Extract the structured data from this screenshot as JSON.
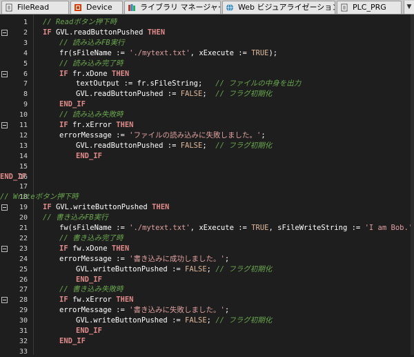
{
  "tabs": [
    {
      "label": "FileRead",
      "icon": "document-icon"
    },
    {
      "label": "Device",
      "icon": "device-icon"
    },
    {
      "label": "ライブラリ マネージャー",
      "icon": "library-icon"
    },
    {
      "label": "Web ビジュアライゼーション",
      "icon": "web-visu-icon"
    },
    {
      "label": "PLC_PRG",
      "icon": "document-icon"
    }
  ],
  "tab_overflow": "▼",
  "lines": [
    {
      "no": "1",
      "tokens": [
        {
          "t": "cm",
          "v": "// Readボタン押下時"
        }
      ]
    },
    {
      "no": "2",
      "tokens": [
        {
          "t": "kw",
          "v": "IF"
        },
        {
          "t": "tx",
          "v": " GVL.readButtonPushed "
        },
        {
          "t": "kw",
          "v": "THEN"
        }
      ]
    },
    {
      "no": "3",
      "tokens": [
        {
          "t": "cm",
          "v": "// 読み込みFB実行"
        }
      ]
    },
    {
      "no": "4",
      "tokens": [
        {
          "t": "tx",
          "v": "fr(sFileName := "
        },
        {
          "t": "st",
          "v": "'./mytext.txt'"
        },
        {
          "t": "tx",
          "v": ", xExecute := "
        },
        {
          "t": "op",
          "v": "TRUE"
        },
        {
          "t": "tx",
          "v": ");"
        }
      ]
    },
    {
      "no": "5",
      "tokens": [
        {
          "t": "cm",
          "v": "// 読み込み完了時"
        }
      ]
    },
    {
      "no": "6",
      "tokens": [
        {
          "t": "kw",
          "v": "IF"
        },
        {
          "t": "tx",
          "v": " fr.xDone "
        },
        {
          "t": "kw",
          "v": "THEN"
        }
      ]
    },
    {
      "no": "7",
      "tokens": [
        {
          "t": "tx",
          "v": "textOutput := fr.sFileString;   "
        },
        {
          "t": "cm",
          "v": "// ファイルの中身を出力"
        }
      ]
    },
    {
      "no": "8",
      "tokens": [
        {
          "t": "tx",
          "v": "GVL.readButtonPushed := "
        },
        {
          "t": "op",
          "v": "FALSE"
        },
        {
          "t": "tx",
          "v": ";  "
        },
        {
          "t": "cm",
          "v": "// フラグ初期化"
        }
      ]
    },
    {
      "no": "9",
      "tokens": [
        {
          "t": "kw",
          "v": "END_IF"
        }
      ]
    },
    {
      "no": "10",
      "tokens": [
        {
          "t": "cm",
          "v": "// 読み込み失敗時"
        }
      ]
    },
    {
      "no": "11",
      "tokens": [
        {
          "t": "kw",
          "v": "IF"
        },
        {
          "t": "tx",
          "v": " fr.xError "
        },
        {
          "t": "kw",
          "v": "THEN"
        }
      ]
    },
    {
      "no": "12",
      "tokens": [
        {
          "t": "tx",
          "v": "errorMessage := "
        },
        {
          "t": "st",
          "v": "'ファイルの読み込みに失敗しました。'"
        },
        {
          "t": "tx",
          "v": ";"
        }
      ]
    },
    {
      "no": "13",
      "tokens": [
        {
          "t": "tx",
          "v": "GVL.readButtonPushed := "
        },
        {
          "t": "op",
          "v": "FALSE"
        },
        {
          "t": "tx",
          "v": ";  "
        },
        {
          "t": "cm",
          "v": "// フラグ初期化"
        }
      ]
    },
    {
      "no": "14",
      "tokens": [
        {
          "t": "kw",
          "v": "END_IF"
        }
      ]
    },
    {
      "no": "15",
      "tokens": []
    },
    {
      "no": "16",
      "tokens": [
        {
          "t": "kw",
          "v": "END_IF"
        }
      ]
    },
    {
      "no": "17",
      "tokens": []
    },
    {
      "no": "18",
      "tokens": [
        {
          "t": "cm",
          "v": "// Writeボタン押下時"
        }
      ]
    },
    {
      "no": "19",
      "tokens": [
        {
          "t": "kw",
          "v": "IF"
        },
        {
          "t": "tx",
          "v": " GVL.writeButtonPushed "
        },
        {
          "t": "kw",
          "v": "THEN"
        }
      ]
    },
    {
      "no": "20",
      "tokens": [
        {
          "t": "cm",
          "v": "// 書き込みFB実行"
        }
      ]
    },
    {
      "no": "21",
      "tokens": [
        {
          "t": "tx",
          "v": "fw(sFileName := "
        },
        {
          "t": "st",
          "v": "'./mytext.txt'"
        },
        {
          "t": "tx",
          "v": ", xExecute := "
        },
        {
          "t": "op",
          "v": "TRUE"
        },
        {
          "t": "tx",
          "v": ", sFileWriteString := "
        },
        {
          "t": "st",
          "v": "'I am Bob.'"
        },
        {
          "t": "tx",
          "v": ");"
        }
      ]
    },
    {
      "no": "22",
      "tokens": [
        {
          "t": "cm",
          "v": "// 書き込み完了時"
        }
      ]
    },
    {
      "no": "23",
      "tokens": [
        {
          "t": "kw",
          "v": "IF"
        },
        {
          "t": "tx",
          "v": " fw.xDone "
        },
        {
          "t": "kw",
          "v": "THEN"
        }
      ]
    },
    {
      "no": "24",
      "tokens": [
        {
          "t": "tx",
          "v": "errorMessage := "
        },
        {
          "t": "st",
          "v": "'書き込みに成功しました。'"
        },
        {
          "t": "tx",
          "v": ";"
        }
      ]
    },
    {
      "no": "25",
      "tokens": [
        {
          "t": "tx",
          "v": "GVL.writeButtonPushed := "
        },
        {
          "t": "op",
          "v": "FALSE"
        },
        {
          "t": "tx",
          "v": "; "
        },
        {
          "t": "cm",
          "v": "// フラグ初期化"
        }
      ]
    },
    {
      "no": "26",
      "tokens": [
        {
          "t": "kw",
          "v": "END_IF"
        }
      ]
    },
    {
      "no": "27",
      "tokens": [
        {
          "t": "cm",
          "v": "// 書き込み失敗時"
        }
      ]
    },
    {
      "no": "28",
      "tokens": [
        {
          "t": "kw",
          "v": "IF"
        },
        {
          "t": "tx",
          "v": " fw.xError "
        },
        {
          "t": "kw",
          "v": "THEN"
        }
      ]
    },
    {
      "no": "29",
      "tokens": [
        {
          "t": "tx",
          "v": "errorMessage := "
        },
        {
          "t": "st",
          "v": "'書き込みに失敗しました。'"
        },
        {
          "t": "tx",
          "v": ";"
        }
      ]
    },
    {
      "no": "30",
      "tokens": [
        {
          "t": "tx",
          "v": "GVL.writeButtonPushed := "
        },
        {
          "t": "op",
          "v": "FALSE"
        },
        {
          "t": "tx",
          "v": "; "
        },
        {
          "t": "cm",
          "v": "// フラグ初期化"
        }
      ]
    },
    {
      "no": "31",
      "tokens": [
        {
          "t": "kw",
          "v": "END_IF"
        }
      ]
    },
    {
      "no": "32",
      "tokens": [
        {
          "t": "kw",
          "v": "END_IF"
        }
      ]
    },
    {
      "no": "33",
      "tokens": []
    }
  ],
  "colors": {
    "background": "#1e1e1e",
    "keyword": "#e18a8a",
    "comment": "#6aa84f",
    "string": "#e0a0a0",
    "text": "#ffffff"
  }
}
